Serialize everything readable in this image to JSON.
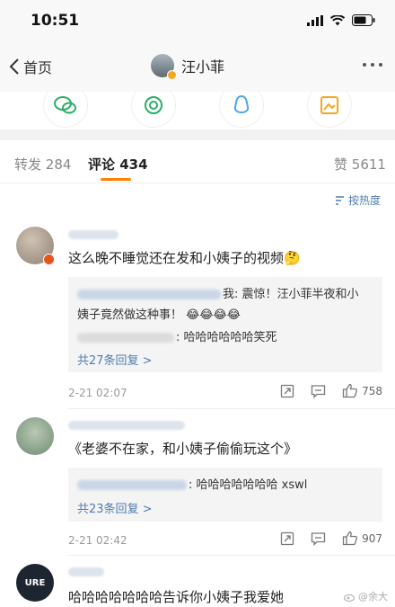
{
  "status": {
    "time": "10:51"
  },
  "nav": {
    "back_label": "首页",
    "title": "汪小菲"
  },
  "tabs": [
    {
      "label": "转发",
      "count": "284"
    },
    {
      "label": "评论",
      "count": "434"
    },
    {
      "label": "赞",
      "count": "5611"
    }
  ],
  "sort": {
    "label": "按热度"
  },
  "comments": [
    {
      "text": "这么晚不睡觉还在发和小姨子的视频",
      "emoji": "🤔",
      "replies": [
        {
          "suffix": "我: 震惊！汪小菲半夜和小",
          "suffix2": "姨子竟然做这种事！",
          "emoji": "😂😂😂😂"
        },
        {
          "suffix": ": 哈哈哈哈哈哈笑死"
        }
      ],
      "more": "共27条回复 >",
      "time": "2-21 02:07",
      "likes": "758"
    },
    {
      "text": "《老婆不在家，和小姨子偷偷玩这个》",
      "replies": [
        {
          "suffix": ": 哈哈哈哈哈哈哈 xswl"
        }
      ],
      "more": "共23条回复 >",
      "time": "2-21 02:42",
      "likes": "907"
    },
    {
      "avatar_text": "URE",
      "text": "哈哈哈哈哈哈哈告诉你小姨子我爱她"
    }
  ],
  "watermark": "@余大",
  "colors": {
    "accent": "#ff8200",
    "link": "#507daf"
  }
}
